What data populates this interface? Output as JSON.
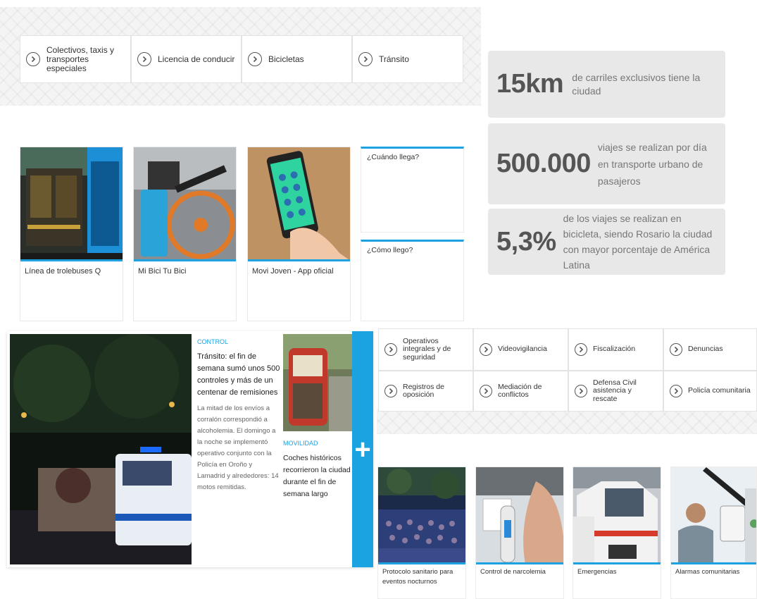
{
  "top_links": [
    {
      "label": "Colectivos, taxis y transportes especiales"
    },
    {
      "label": "Licencia de conducir"
    },
    {
      "label": "Bicicletas"
    },
    {
      "label": "Tránsito"
    }
  ],
  "cards": [
    {
      "caption": "Línea de trolebuses Q"
    },
    {
      "caption": "Mi Bici Tu Bici"
    },
    {
      "caption": "Movi Joven - App oficial"
    }
  ],
  "questions": [
    {
      "label": "¿Cuándo llega?"
    },
    {
      "label": "¿Cómo llego?"
    }
  ],
  "stats": [
    {
      "number": "15km",
      "text": "de carriles exclusivos tiene la ciudad"
    },
    {
      "number": "500.000",
      "text": "viajes se realizan por día en transporte urbano de pasajeros"
    },
    {
      "number": "5,3%",
      "text": "de los viajes se realizan en bicicleta, siendo Rosario la ciudad con mayor porcentaje de América Latina"
    }
  ],
  "news": {
    "main": {
      "kicker": "CONTROL",
      "headline": "Tránsito: el fin de semana sumó unos 500 controles y más de un centenar de remisiones",
      "body": "La mitad de los envíos a corralón correspondió a alcoholemia. El domingo a la noche se implementó operativo conjunto con la Policía en Oroño y Lamadrid y alrededores: 14 motos remitidas."
    },
    "second": {
      "kicker": "MOVILIDAD",
      "headline": "Coches históricos recorrieron la ciudad durante el fin de semana largo"
    },
    "more_label": "+"
  },
  "security_links": [
    {
      "label": "Operativos integrales y de seguridad"
    },
    {
      "label": "Videovigilancia"
    },
    {
      "label": "Fiscalización"
    },
    {
      "label": "Denuncias"
    },
    {
      "label": "Registros de oposición"
    },
    {
      "label": "Mediación de conflictos"
    },
    {
      "label": "Defensa Civil asistencia y rescate"
    },
    {
      "label": "Policía comunitaria"
    }
  ],
  "bottom_cards": [
    {
      "caption": "Protocolo sanitario para eventos nocturnos"
    },
    {
      "caption": "Control de narcolemia"
    },
    {
      "caption": "Emergencias"
    },
    {
      "caption": "Alarmas comunitarias"
    }
  ],
  "colors": {
    "accent": "#1aa3e0",
    "stat_bg": "#e8e8e8"
  }
}
